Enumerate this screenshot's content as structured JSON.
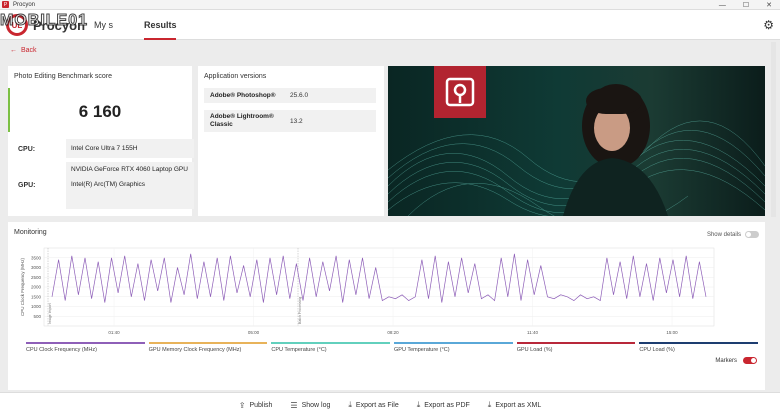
{
  "window": {
    "title": "Procyon",
    "minimize": "—",
    "maximize": "☐",
    "close": "✕"
  },
  "header": {
    "logo_mark": "UL",
    "app_name": "Procyon",
    "watermark": "MOBILE01",
    "tabs": [
      {
        "label": "My s"
      },
      {
        "label": "Results"
      }
    ]
  },
  "back": {
    "label": "Back"
  },
  "score": {
    "title": "Photo Editing Benchmark score",
    "value": "6 160",
    "cpu_label": "CPU:",
    "cpu_value": "Intel Core Ultra 7 155H",
    "gpu_label": "GPU:",
    "gpu_values": [
      "NVIDIA GeForce RTX 4060 Laptop GPU",
      "Intel(R) Arc(TM) Graphics"
    ]
  },
  "app_versions": {
    "title": "Application versions",
    "rows": [
      {
        "name": "Adobe® Photoshop®",
        "version": "25.6.0"
      },
      {
        "name": "Adobe® Lightroom® Classic",
        "version": "13.2"
      }
    ]
  },
  "monitoring": {
    "title": "Monitoring",
    "show_details": "Show details",
    "markers_label": "Markers",
    "legend": [
      {
        "label": "CPU Clock Frequency (MHz)",
        "color": "#8e5fb8"
      },
      {
        "label": "GPU Memory Clock Frequency (MHz)",
        "color": "#e8b35a"
      },
      {
        "label": "CPU Temperature (°C)",
        "color": "#62d0bd"
      },
      {
        "label": "GPU Temperature (°C)",
        "color": "#5aa8d8"
      },
      {
        "label": "GPU Load (%)",
        "color": "#b8283a"
      },
      {
        "label": "CPU Load (%)",
        "color": "#1d3d70"
      }
    ]
  },
  "chart_data": {
    "type": "line",
    "ylabel": "CPU Clock Frequency (MHz)",
    "y_ticks": [
      500,
      1000,
      1500,
      2000,
      2500,
      3000,
      3500
    ],
    "x_ticks": [
      "01:40",
      "05:00",
      "08:20",
      "11:40",
      "15:00"
    ],
    "ylim": [
      0,
      4000
    ],
    "grid": true,
    "markers": [
      "Image Import",
      "Batch Processing"
    ],
    "series": [
      {
        "name": "CPU Clock Frequency (MHz)",
        "color": "#8e5fb8",
        "values": [
          1500,
          3400,
          1300,
          3600,
          1600,
          3500,
          1400,
          3300,
          1200,
          3500,
          1700,
          3600,
          1500,
          3200,
          1300,
          3400,
          1800,
          3500,
          1200,
          3000,
          1600,
          3700,
          1400,
          3300,
          1500,
          3500,
          1300,
          3600,
          1700,
          3100,
          1500,
          3400,
          1200,
          3500,
          1600,
          3600,
          1400,
          3200,
          1300,
          3500,
          1500,
          3300,
          1800,
          3600,
          1200,
          3400,
          1600,
          3500,
          1400,
          3000,
          1300,
          1500,
          1400,
          1600,
          1300,
          1500,
          3400,
          1400,
          3600,
          1200,
          3300,
          1500,
          3500,
          1700,
          3200,
          1400,
          1600,
          1300,
          3500,
          1500,
          3700,
          1300,
          3400,
          1600,
          3100,
          1500,
          1400,
          1600,
          1500,
          1300,
          1600,
          1400,
          1500,
          1300,
          3500,
          1600,
          3300,
          1400,
          3600,
          1500,
          3200,
          1300,
          3500,
          1700,
          3400,
          1500,
          3600,
          1400,
          3300,
          1500
        ]
      }
    ]
  },
  "footer": {
    "buttons": [
      {
        "label": "Publish",
        "icon": "⇪"
      },
      {
        "label": "Show log",
        "icon": "☰"
      },
      {
        "label": "Export as File",
        "icon": "⤓"
      },
      {
        "label": "Export as PDF",
        "icon": "⤓"
      },
      {
        "label": "Export as XML",
        "icon": "⤓"
      }
    ]
  }
}
